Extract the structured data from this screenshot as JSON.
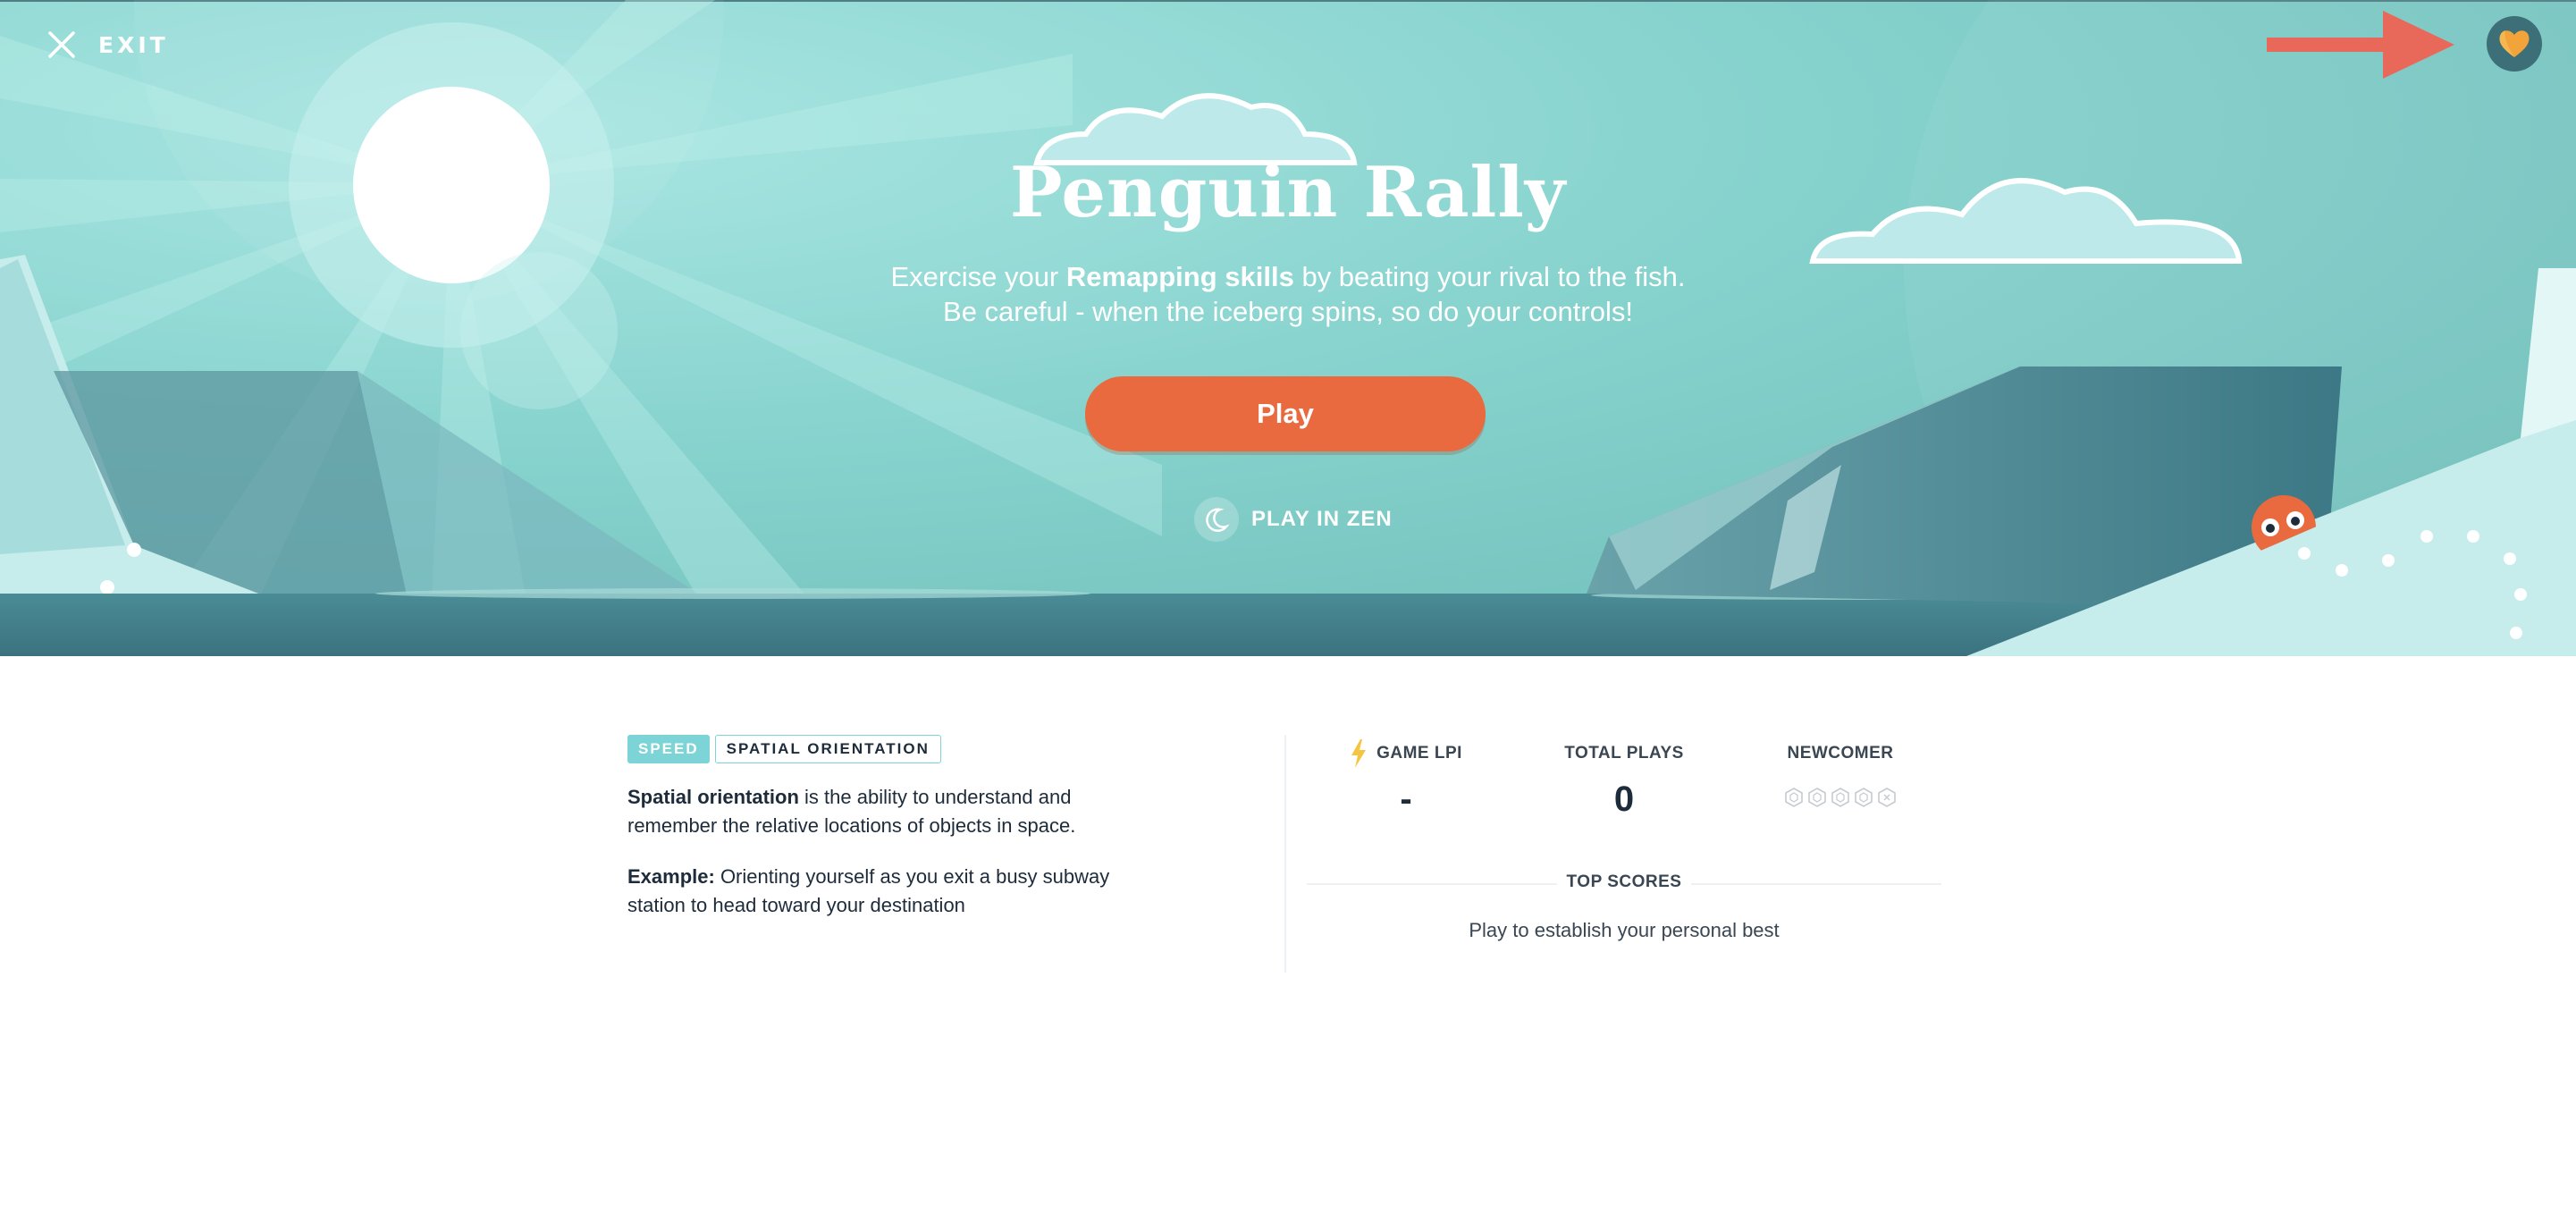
{
  "header": {
    "exit_label": "EXIT",
    "exit_icon": "close-icon",
    "favorite_icon": "heart-icon",
    "annotation_arrow_color": "#e8695a"
  },
  "game": {
    "title": "Penguin Rally",
    "description_prefix": "Exercise your ",
    "description_bold": "Remapping skills",
    "description_suffix": " by beating your rival to the fish. Be careful - when the iceberg spins, so do your controls!",
    "play_label": "Play",
    "zen_label": "PLAY IN ZEN",
    "zen_icon": "moon-icon"
  },
  "tags": {
    "speed": "SPEED",
    "skill": "SPATIAL ORIENTATION"
  },
  "info": {
    "definition_term": "Spatial orientation",
    "definition_text": " is the ability to understand and remember the relative locations of objects in space.",
    "example_label": "Example:",
    "example_text": " Orienting yourself as you exit a busy subway station to head toward your destination"
  },
  "stats": {
    "lpi_label": "GAME LPI",
    "lpi_icon": "lightning-icon",
    "lpi_value": "-",
    "plays_label": "TOTAL PLAYS",
    "plays_value": "0",
    "level_label": "NEWCOMER",
    "level_icons": [
      "hexagon-icon",
      "hexagon-icon",
      "hexagon-icon",
      "hexagon-icon",
      "hexagon-icon"
    ]
  },
  "top_scores": {
    "label": "TOP SCORES",
    "empty_message": "Play to establish your personal best"
  },
  "colors": {
    "accent": "#e96a3e",
    "teal": "#7dd4d6",
    "hero_sky": "#7fcfcc",
    "text": "#1d2b3a"
  }
}
